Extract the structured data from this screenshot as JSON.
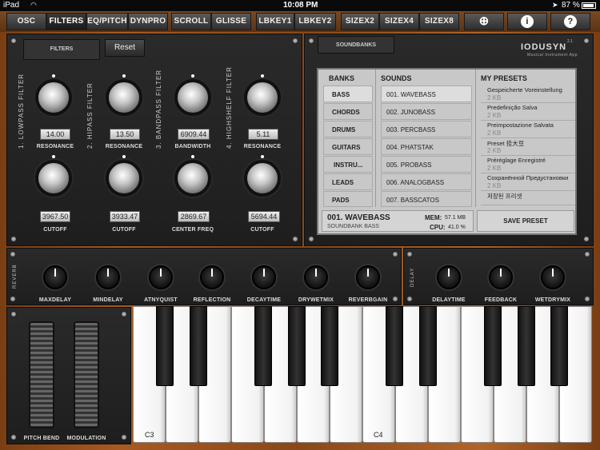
{
  "status": {
    "device": "iPad",
    "time": "10:08 PM",
    "battery": "87 %"
  },
  "toolbar": {
    "osc": "OSC",
    "filters": "FILTERS",
    "eqpitch": "EQ/PITCH",
    "dynpro": "DYNPRO",
    "scroll": "SCROLL",
    "glisse": "GLISSE",
    "lbkey1": "LBKEY1",
    "lbkey2": "LBKEY2",
    "sizex2": "SIZEX2",
    "sizex4": "SIZEX4",
    "sizex8": "SIZEX8"
  },
  "filters": {
    "tab": "FILTERS",
    "reset": "Reset",
    "sections": [
      {
        "title": "1. LOWPASS FILTER",
        "top_value": "14.00",
        "top_label": "RESONANCE",
        "bottom_value": "3967.50",
        "bottom_label": "CUTOFF"
      },
      {
        "title": "2. HIPASS FILTER",
        "top_value": "13.50",
        "top_label": "RESONANCE",
        "bottom_value": "3933.47",
        "bottom_label": "CUTOFF"
      },
      {
        "title": "3. BANDPASS FILTER",
        "top_value": "6909.44",
        "top_label": "BANDWIDTH",
        "bottom_value": "2869.67",
        "bottom_label": "CENTER FREQ"
      },
      {
        "title": "4. HIGHSHELF FILTER",
        "top_value": "5.11",
        "top_label": "RESONANCE",
        "bottom_value": "5694.44",
        "bottom_label": "CUTOFF"
      }
    ]
  },
  "soundbanks": {
    "tab": "SOUNDBANKS",
    "brand": "IODUSYN",
    "brand_version": "2.1",
    "brand_sub": "Musical Instrument App",
    "banks_header": "BANKS",
    "sounds_header": "SOUNDS",
    "presets_header": "MY PRESETS",
    "banks": [
      "BASS",
      "CHORDS",
      "DRUMS",
      "GUITARS",
      "INSTRU...",
      "LEADS",
      "PADS"
    ],
    "sounds": [
      "001. WAVEBASS",
      "002. JUNOBASS",
      "003. PERCBASS",
      "004. PHATSTAK",
      "005. PROBASS",
      "006. ANALOGBASS",
      "007. BASSCATOS"
    ],
    "presets": [
      {
        "name": "Gespeicherte Voreinstellung",
        "size": "2 KB"
      },
      {
        "name": "Predefinição Salva",
        "size": "2 KB"
      },
      {
        "name": "Preimpostazione Salvata",
        "size": "2 KB"
      },
      {
        "name": "Preset 挂大豆",
        "size": "2 KB"
      },
      {
        "name": "Préréglage Enregistré",
        "size": "2 KB"
      },
      {
        "name": "Сохранённой Предустановки",
        "size": "2 KB"
      },
      {
        "name": "저장된 프리셋",
        "size": ""
      }
    ],
    "current_name": "001. WAVEBASS",
    "current_bank": "SOUNDBANK BASS",
    "mem_label": "MEM:",
    "mem_value": "57.1 MB",
    "cpu_label": "CPU:",
    "cpu_value": "41.0 %",
    "save_preset": "SAVE PRESET"
  },
  "reverb": {
    "label": "REVERB",
    "knobs": [
      "MAXDELAY",
      "MINDELAY",
      "ATNYQUIST",
      "REFLECTION",
      "DECAYTIME",
      "DRYWETMIX",
      "REVERBGAIN"
    ]
  },
  "delay": {
    "label": "DELAY",
    "knobs": [
      "DELAYTIME",
      "FEEDBACK",
      "WETDRYMIX"
    ]
  },
  "wheels": {
    "pitch": "PITCH BEND",
    "mod": "MODULATION"
  },
  "keyboard": {
    "c3": "C3",
    "c4": "C4"
  }
}
